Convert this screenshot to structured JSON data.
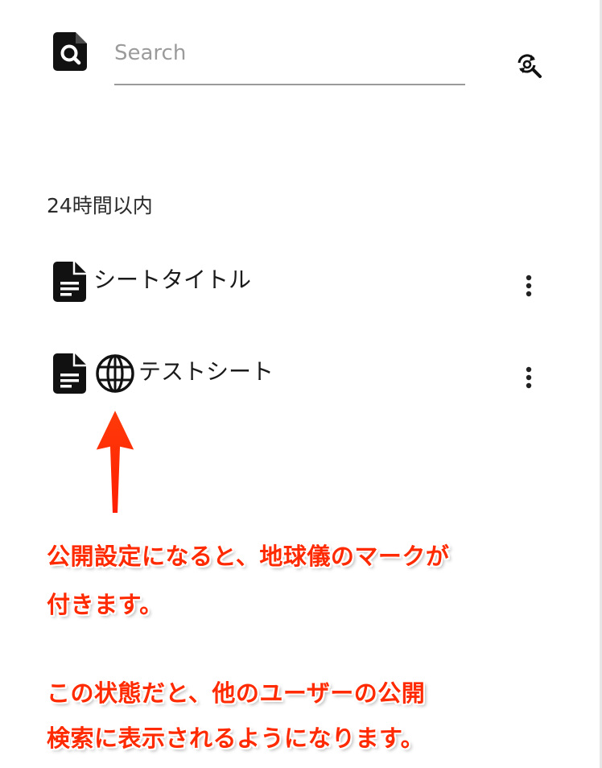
{
  "search": {
    "placeholder": "Search",
    "value": ""
  },
  "icons": {
    "app_logo": "document-search-icon",
    "refresh": "refresh-search-icon",
    "document": "document-icon",
    "public": "globe-icon",
    "more": "more-vert-icon"
  },
  "section": {
    "heading": "24時間以内"
  },
  "files": [
    {
      "title": "シートタイトル",
      "public": false
    },
    {
      "title": "テストシート",
      "public": true
    }
  ],
  "annotation": {
    "lines": [
      "公開設定になると、地球儀のマークが",
      "付きます。",
      "この状態だと、他のユーザーの公開",
      "検索に表示されるようになります。"
    ],
    "color": "#ff2a00"
  },
  "colors": {
    "icon": "#111111",
    "underline": "#9a9a9a",
    "placeholder": "#9b9b9b",
    "annotation": "#ff2a00"
  }
}
